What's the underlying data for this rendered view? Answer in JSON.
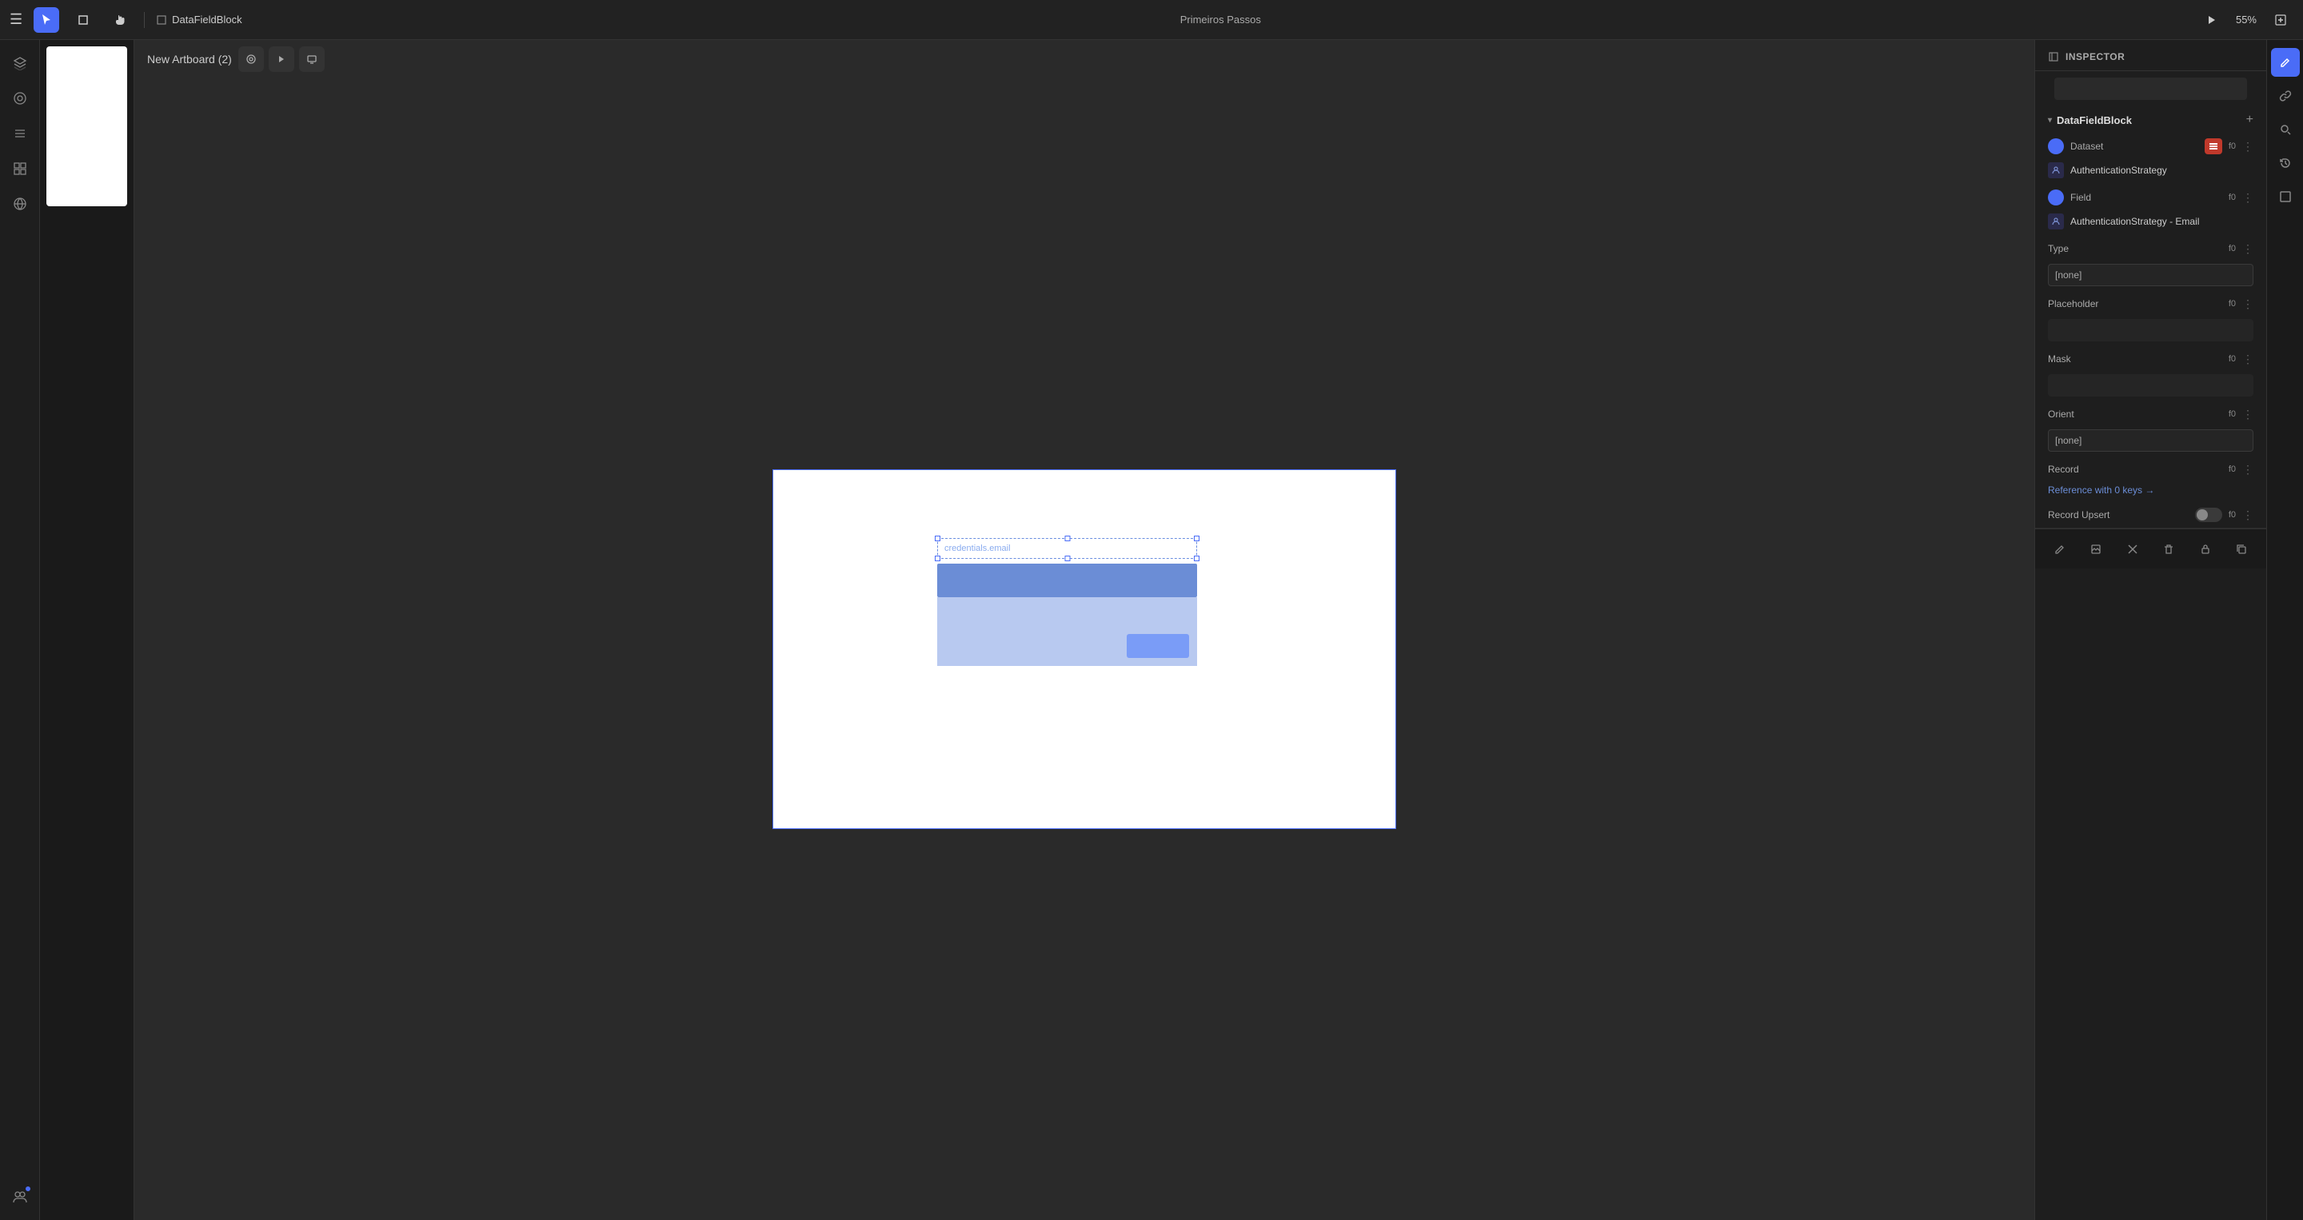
{
  "topbar": {
    "menu_icon": "☰",
    "tool_select": "↖",
    "tool_crop": "⬜",
    "tool_hand": "✋",
    "filename_icon": "⬜",
    "filename": "DataFieldBlock",
    "center_title": "Primeiros Passos",
    "play_icon": "▶",
    "zoom": "55%",
    "share_icon": "⬜"
  },
  "left_sidebar": {
    "icons": [
      {
        "name": "layers-icon",
        "symbol": "⊞",
        "active": false
      },
      {
        "name": "components-icon",
        "symbol": "◎",
        "active": false
      },
      {
        "name": "assets-icon",
        "symbol": "☰",
        "active": false
      },
      {
        "name": "grid-icon",
        "symbol": "⊟",
        "active": false
      },
      {
        "name": "globe-icon",
        "symbol": "⊕",
        "active": false
      }
    ],
    "bottom_icons": [
      {
        "name": "collab-icon",
        "symbol": "◉",
        "badge": true
      }
    ]
  },
  "canvas": {
    "artboard_label": "New Artboard (2)",
    "tool_preview": "◎",
    "tool_play": "▶",
    "tool_screen": "⬜",
    "field_text": "credentials.email"
  },
  "inspector": {
    "label": "INSPECTOR",
    "section_title": "DataFieldBlock",
    "add_icon": "+",
    "rows": [
      {
        "type": "prop",
        "label": "Dataset",
        "has_circle": true,
        "circle_color": "#4a6cf7",
        "has_dataset_icon": true,
        "f0": "f0",
        "dots": "⋮"
      },
      {
        "type": "sub",
        "label": "AuthenticationStrategy"
      },
      {
        "type": "prop",
        "label": "Field",
        "has_circle": true,
        "circle_color": "#4a6cf7",
        "f0": "f0",
        "dots": "⋮"
      },
      {
        "type": "sub",
        "label": "AuthenticationStrategy - Email"
      },
      {
        "type": "prop",
        "label": "Type",
        "f0": "f0",
        "dots": "⋮"
      },
      {
        "type": "input",
        "value": "[none]"
      },
      {
        "type": "prop",
        "label": "Placeholder",
        "f0": "f0",
        "dots": "⋮"
      },
      {
        "type": "empty_input"
      },
      {
        "type": "prop",
        "label": "Mask",
        "f0": "f0",
        "dots": "⋮"
      },
      {
        "type": "empty_input"
      },
      {
        "type": "prop",
        "label": "Orient",
        "f0": "f0",
        "dots": "⋮"
      },
      {
        "type": "input",
        "value": "[none]"
      },
      {
        "type": "prop",
        "label": "Record",
        "f0": "f0",
        "dots": "⋮"
      },
      {
        "type": "reference",
        "text": "Reference with 0 keys →"
      },
      {
        "type": "toggle_row",
        "label": "Record Upsert",
        "f0": "f0",
        "dots": "⋮",
        "checked": false
      }
    ],
    "bottom_buttons": [
      {
        "name": "edit-icon",
        "symbol": "✏"
      },
      {
        "name": "image-icon",
        "symbol": "⬜"
      },
      {
        "name": "close-icon",
        "symbol": "✕"
      },
      {
        "name": "delete-icon",
        "symbol": "🗑"
      },
      {
        "name": "lock-icon",
        "symbol": "🔒"
      },
      {
        "name": "copy-icon",
        "symbol": "⬜"
      }
    ]
  },
  "far_right": {
    "icons": [
      {
        "name": "edit-active-icon",
        "symbol": "✏",
        "accent": true
      },
      {
        "name": "link-icon",
        "symbol": "🔗"
      },
      {
        "name": "search-icon",
        "symbol": "🔍"
      },
      {
        "name": "history-icon",
        "symbol": "⟳"
      },
      {
        "name": "responsive-icon",
        "symbol": "⊡"
      }
    ]
  }
}
